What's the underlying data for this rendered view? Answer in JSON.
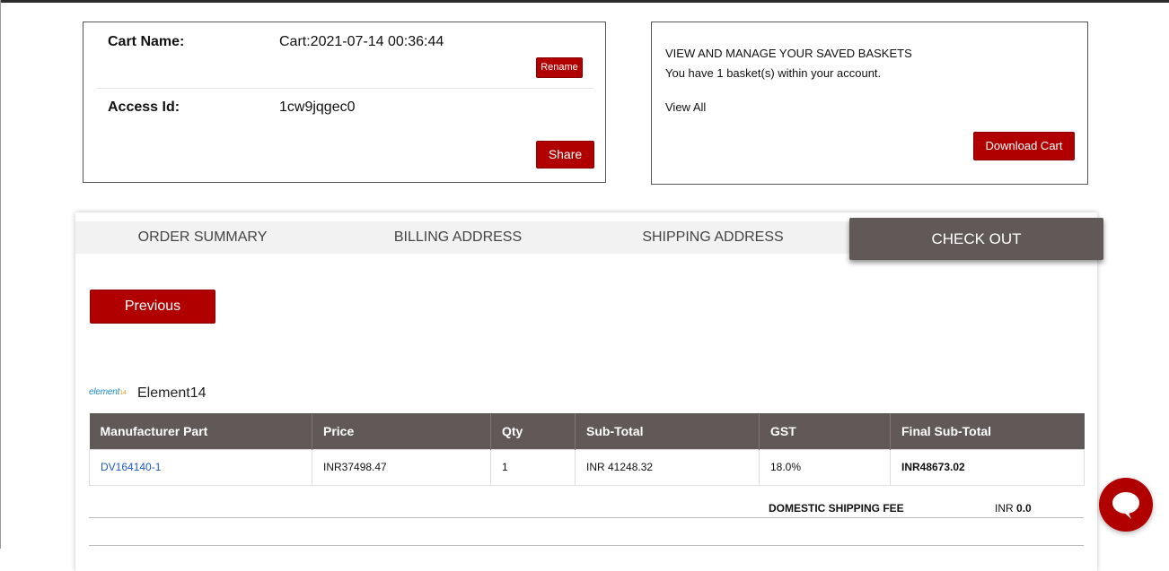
{
  "cart": {
    "name_label": "Cart Name:",
    "name_value": "Cart:2021-07-14 00:36:44",
    "rename_label": "Rename",
    "access_label": "Access Id:",
    "access_value": "1cw9jqgec0",
    "share_label": "Share"
  },
  "baskets": {
    "heading": "VIEW AND MANAGE YOUR SAVED BASKETS",
    "count_text": "You have 1 basket(s) within your account.",
    "view_all": "View All",
    "download_label": "Download Cart"
  },
  "tabs": [
    {
      "label": "ORDER SUMMARY"
    },
    {
      "label": "BILLING ADDRESS"
    },
    {
      "label": "SHIPPING ADDRESS"
    },
    {
      "label": "CHECK OUT"
    }
  ],
  "previous_label": "Previous",
  "distributor": {
    "logo_text": "element",
    "logo_sup": "14",
    "name": "Element14"
  },
  "table": {
    "headers": [
      "Manufacturer Part",
      "Price",
      "Qty",
      "Sub-Total",
      "GST",
      "Final Sub-Total"
    ],
    "rows": [
      {
        "part": "DV164140-1",
        "price": "INR37498.47",
        "qty": "1",
        "subtotal": "INR 41248.32",
        "gst": "18.0%",
        "final": "INR48673.02"
      }
    ]
  },
  "shipping": {
    "label": "DOMESTIC SHIPPING FEE",
    "currency": "INR",
    "value": "0.0"
  },
  "colors": {
    "accent_red": "#b10000",
    "tab_active_bg": "#615858",
    "link_blue": "#1a5bc4"
  }
}
